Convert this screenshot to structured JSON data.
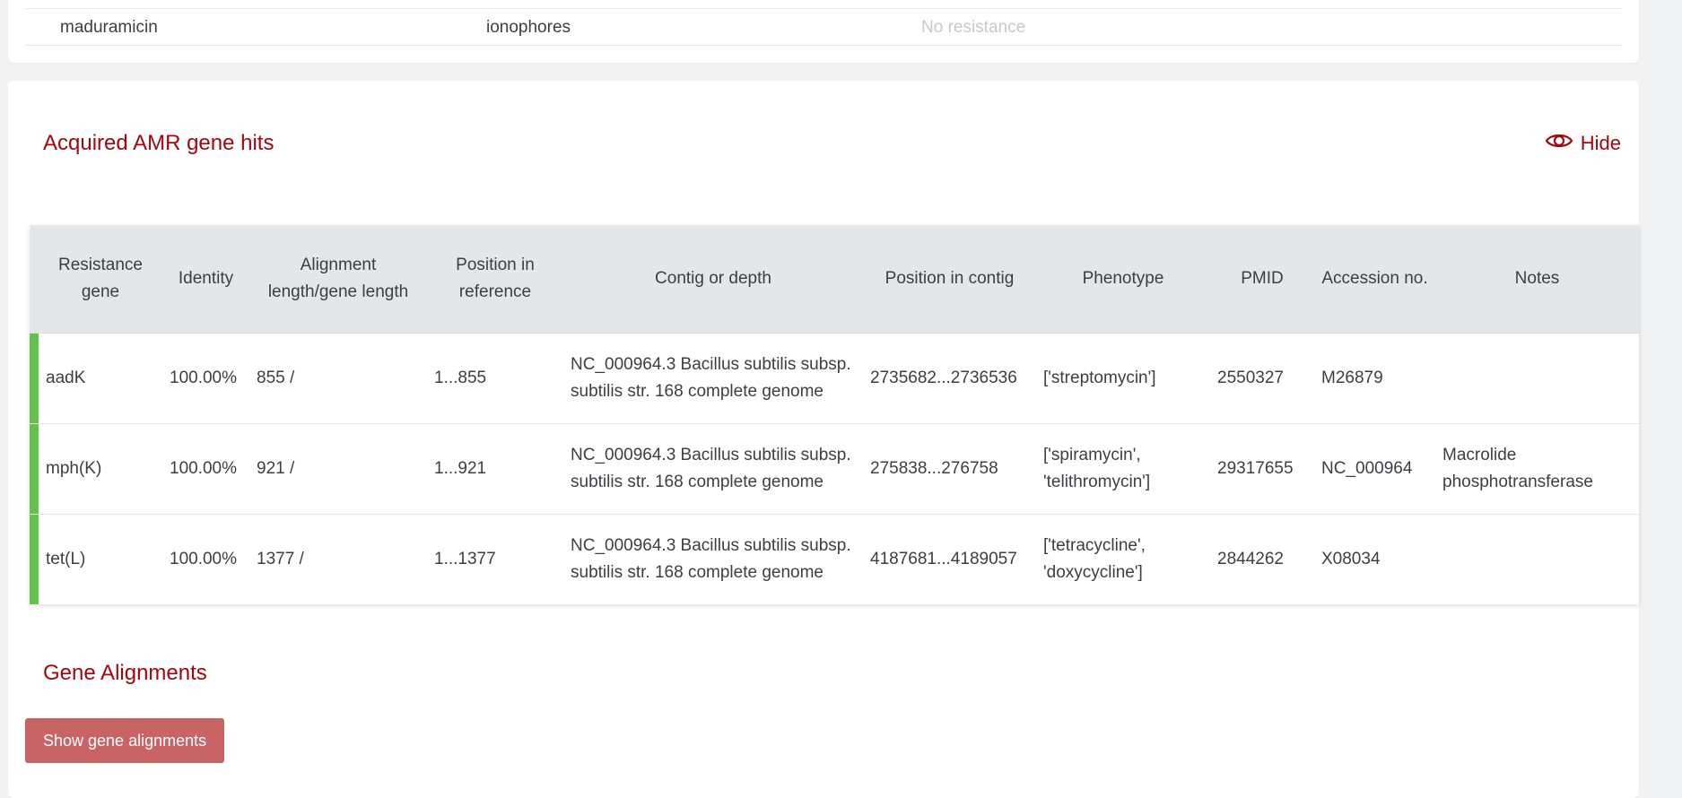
{
  "previous_row": {
    "antimicrobial": "maduramicin",
    "class": "ionophores",
    "status": "No resistance"
  },
  "section": {
    "title": "Acquired AMR gene hits",
    "hide_label": "Hide"
  },
  "table": {
    "headers": [
      "Resistance gene",
      "Identity",
      "Alignment length/gene length",
      "Position in reference",
      "Contig or depth",
      "Position in contig",
      "Phenotype",
      "PMID",
      "Accession no.",
      "Notes"
    ],
    "rows": [
      {
        "gene": "aadK",
        "identity": "100.00%",
        "alignment": "855 /",
        "position_ref": "1...855",
        "contig": "NC_000964.3 Bacillus subtilis subsp. subtilis str. 168 complete genome",
        "position_contig": "2735682...2736536",
        "phenotype": "['streptomycin']",
        "pmid": "2550327",
        "accession": "M26879",
        "notes": ""
      },
      {
        "gene": "mph(K)",
        "identity": "100.00%",
        "alignment": "921 /",
        "position_ref": "1...921",
        "contig": "NC_000964.3 Bacillus subtilis subsp. subtilis str. 168 complete genome",
        "position_contig": "275838...276758",
        "phenotype": "['spiramycin', 'telithromycin']",
        "pmid": "29317655",
        "accession": "NC_000964",
        "notes": "Macrolide phosphotransferase"
      },
      {
        "gene": "tet(L)",
        "identity": "100.00%",
        "alignment": "1377 /",
        "position_ref": "1...1377",
        "contig": "NC_000964.3 Bacillus subtilis subsp. subtilis str. 168 complete genome",
        "position_contig": "4187681...4189057",
        "phenotype": "['tetracycline', 'doxycycline']",
        "pmid": "2844262",
        "accession": "X08034",
        "notes": ""
      }
    ]
  },
  "alignments": {
    "title": "Gene Alignments",
    "button_label": "Show gene alignments"
  },
  "colors": {
    "accent": "#a3060d",
    "row_marker": "#62c24a",
    "button": "#c86366"
  }
}
